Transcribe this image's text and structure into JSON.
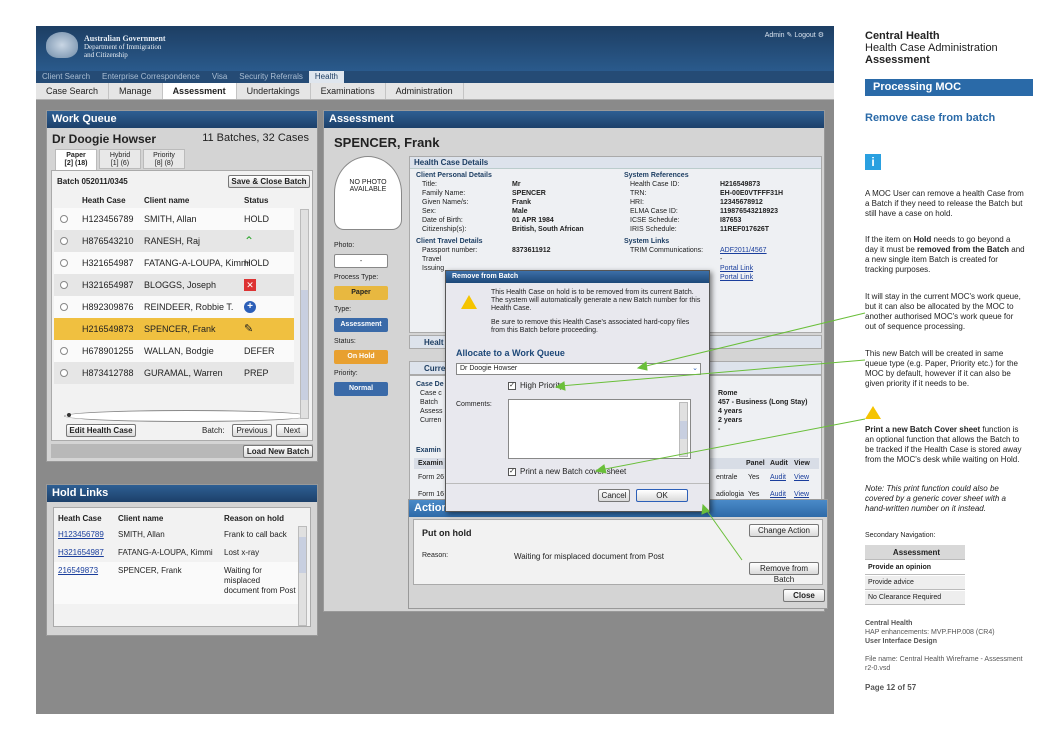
{
  "banner": {
    "gov_line1": "Australian Government",
    "gov_line2": "Department of Immigration",
    "gov_line3": "and Citizenship",
    "user": "Admin",
    "logout": "Logout"
  },
  "nav": [
    "Client Search",
    "Enterprise Correspondence",
    "Visa",
    "Security Referrals",
    "Health"
  ],
  "subnav": [
    "Case Search",
    "Manage",
    "Assessment",
    "Undertakings",
    "Examinations",
    "Administration"
  ],
  "wq": {
    "title": "Work Queue",
    "doctor": "Dr Doogie Howser",
    "count": "11 Batches, 32 Cases",
    "tabs": [
      {
        "l1": "Paper",
        "l2": "[2] (18)"
      },
      {
        "l1": "Hybrid",
        "l2": "[1] (6)"
      },
      {
        "l1": "Priority",
        "l2": "[8] (8)"
      }
    ],
    "batch": "Batch 052011/0345",
    "save_btn": "Save & Close Batch",
    "h_case": "Heath Case",
    "h_client": "Client name",
    "h_status": "Status",
    "rows": [
      {
        "id": "H123456789",
        "name": "SMITH, Allan",
        "status": "HOLD"
      },
      {
        "id": "H876543210",
        "name": "RANESH, Raj",
        "status": ""
      },
      {
        "id": "H321654987",
        "name": "FATANG-A-LOUPA, Kimmi",
        "status": "HOLD"
      },
      {
        "id": "H321654987",
        "name": "BLOGGS, Joseph",
        "status": ""
      },
      {
        "id": "H892309876",
        "name": "REINDEER, Robbie T.",
        "status": ""
      },
      {
        "id": "H216549873",
        "name": "SPENCER, Frank",
        "status": ""
      },
      {
        "id": "H678901255",
        "name": "WALLAN, Bodgie",
        "status": "DEFER"
      },
      {
        "id": "H873412788",
        "name": "GURAMAL, Warren",
        "status": "PREP"
      }
    ],
    "edit_btn": "Edit Health Case",
    "batch_lbl": "Batch:",
    "prev_btn": "Previous",
    "next_btn": "Next",
    "load_btn": "Load New Batch"
  },
  "hold": {
    "title": "Hold Links",
    "h1": "Heath Case",
    "h2": "Client name",
    "h3": "Reason on hold",
    "rows": [
      {
        "id": "H123456789",
        "name": "SMITH, Allan",
        "reason": "Frank to call back"
      },
      {
        "id": "H321654987",
        "name": "FATANG-A-LOUPA, Kimmi",
        "reason": "Lost x-ray"
      },
      {
        "id": "216549873",
        "name": "SPENCER, Frank",
        "reason": "Waiting for misplaced document from Post"
      }
    ]
  },
  "assess": {
    "title": "Assessment",
    "name": "SPENCER, Frank",
    "photo": "NO PHOTO AVAILABLE",
    "photo_lbl": "Photo:",
    "dash": "-",
    "ptype_lbl": "Process Type:",
    "ptype": "Paper",
    "type_lbl": "Type:",
    "type": "Assessment",
    "status_lbl": "Status:",
    "status": "On Hold",
    "prio_lbl": "Priority:",
    "prio": "Normal",
    "hcd": "Health Case Details",
    "cpd": "Client Personal Details",
    "personal": [
      [
        "Title:",
        "Mr"
      ],
      [
        "Family Name:",
        "SPENCER"
      ],
      [
        "Given Name/s:",
        "Frank"
      ],
      [
        "Sex:",
        "Male"
      ],
      [
        "Date of Birth:",
        "01 APR 1984"
      ],
      [
        "Citizenship(s):",
        "British, South African"
      ]
    ],
    "sysref": "System References",
    "refs": [
      [
        "Health Case ID:",
        "H216549873"
      ],
      [
        "TRN:",
        "EH-00E0VTFFF31H"
      ],
      [
        "HRI:",
        "12345678912"
      ],
      [
        "ELMA Case ID:",
        "119876543218923"
      ],
      [
        "ICSE Schedule:",
        "I87653"
      ],
      [
        "IRIS Schedule:",
        "11REF017626T"
      ]
    ],
    "ctd": "Client Travel Details",
    "passport": "Passport number:",
    "passport_v": "8373611912",
    "travel": "Travel",
    "issuing": "Issuing",
    "syslinks": "System Links",
    "trim": "TRIM Communications:",
    "trim_v": "ADF2011/4567",
    "portal1": "Portal Link",
    "portal2": "Portal Link",
    "sec2": "Healt",
    "sec3": "Curren",
    "cd": "Case De",
    "cc": "Case c",
    "bc": "Batch",
    "as": "Assess",
    "cu": "Curren",
    "rome": "Rome",
    "visa": "457 - Business (Long Stay)",
    "y4": "4 years",
    "y2": "2 years",
    "exam": "Examin",
    "panel": "Panel",
    "audit_h": "Audit",
    "view_h": "View",
    "f26": "Form 26",
    "f16": "Form 16",
    "ctr": "entrale",
    "rad": "adiologia",
    "yes": "Yes",
    "audit": "Audit",
    "view": "View"
  },
  "action": {
    "title": "Action",
    "put": "Put on hold",
    "change": "Change Action",
    "reason_lbl": "Reason:",
    "reason": "Waiting for misplaced document from Post",
    "remove": "Remove from Batch",
    "close": "Close"
  },
  "modal": {
    "title": "Remove from Batch",
    "t1": "This Health Case on hold is to be removed from its current Batch. The system will automatically generate a new Batch number for this Health Case.",
    "t2": "Be sure to remove this Health Case's associated hard-copy files from this Batch before proceeding.",
    "alloc": "Allocate to a Work Queue",
    "select": "Dr Doogie Howser",
    "hp": "High Priority",
    "comments": "Comments:",
    "print": "Print a new Batch cover sheet",
    "cancel": "Cancel",
    "ok": "OK"
  },
  "side": {
    "h1": "Central Health",
    "h2": "Health Case Administration",
    "h3": "Assessment",
    "proc": "Processing MOC",
    "remove": "Remove case from batch",
    "p1": "A MOC User can remove a health Case from a Batch if they need to release the Batch but still have a case on hold.",
    "p2a": "If the item on ",
    "p2b": "Hold",
    "p2c": " needs to go beyond a day it must be ",
    "p2d": "removed from the Batch",
    "p2e": " and a new single item Batch is created for tracking purposes.",
    "p3": "It will stay in the current MOC's work queue, but it can also be allocated by the MOC to another authorised MOC's work queue for out of sequence processing.",
    "p4": "This new Batch will be created in same queue type (e.g. Paper, Priority etc.) for the MOC by default, however if it can also be given priority if it needs to be.",
    "p5a": "Print a new Batch Cover sheet",
    "p5b": " function is an optional function that allows the Batch to be tracked if the Health Case is stored away from the MOC's desk while waiting on Hold.",
    "note": "Note: This print function could also be covered by a generic cover sheet with a hand-written number on it instead.",
    "secnav": "Secondary Navigation:",
    "nav_hdr": "Assessment",
    "nav_items": [
      "Provide an opinion",
      "Provide advice",
      "No Clearance Required"
    ],
    "f1": "Central Health",
    "f2": "HAP enhancements: MVP.FHP.008 (CR4)",
    "f3": "User Interface Design",
    "file": "File name: Central Health Wireframe - Assessment r2-0.vsd",
    "page": "Page 12 of 57"
  }
}
